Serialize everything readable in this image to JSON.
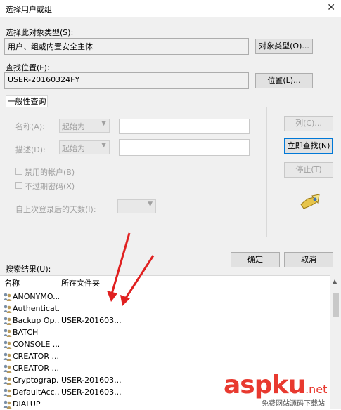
{
  "window": {
    "title": "选择用户或组",
    "close_glyph": "✕"
  },
  "object_type": {
    "label": "选择此对象类型(S):",
    "value": "用户、组或内置安全主体",
    "button": "对象类型(O)..."
  },
  "location": {
    "label": "查找位置(F):",
    "value": "USER-20160324FY",
    "button": "位置(L)..."
  },
  "query": {
    "tab": "一般性查询",
    "name_label": "名称(A):",
    "desc_label": "描述(D):",
    "starts_with": "起始为",
    "disabled_accounts": "禁用的帐户(B)",
    "no_expire_pwd": "不过期密码(X)",
    "days_label": "自上次登录后的天数(I):"
  },
  "side_buttons": {
    "columns": "列(C)...",
    "find_now": "立即查找(N)",
    "stop": "停止(T)"
  },
  "actions": {
    "ok": "确定",
    "cancel": "取消"
  },
  "results": {
    "label": "搜索结果(U):",
    "col_name": "名称",
    "col_folder": "所在文件夹",
    "rows": [
      {
        "name": "ANONYMO...",
        "folder": ""
      },
      {
        "name": "Authenticat...",
        "folder": ""
      },
      {
        "name": "Backup Op...",
        "folder": "USER-201603..."
      },
      {
        "name": "BATCH",
        "folder": ""
      },
      {
        "name": "CONSOLE ...",
        "folder": ""
      },
      {
        "name": "CREATOR ...",
        "folder": ""
      },
      {
        "name": "CREATOR ...",
        "folder": ""
      },
      {
        "name": "Cryptograp...",
        "folder": "USER-201603..."
      },
      {
        "name": "DefaultAcc...",
        "folder": "USER-201603..."
      },
      {
        "name": "DIALUP",
        "folder": ""
      }
    ]
  },
  "watermark": {
    "brand": "aspku",
    "tld": ".net",
    "sub": "免费网站源码下载站"
  },
  "colors": {
    "accent": "#0078d7",
    "arrow": "#e02020",
    "watermark": "#e8392f"
  }
}
